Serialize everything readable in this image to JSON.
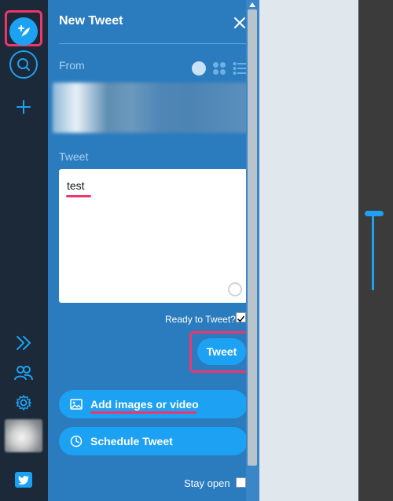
{
  "compose": {
    "title": "New Tweet",
    "from_label": "From",
    "tweet_label": "Tweet",
    "tweet_text": "test",
    "ready_label": "Ready to Tweet?",
    "ready_checked": true,
    "tweet_button": "Tweet",
    "add_media_button": "Add images or video",
    "schedule_button": "Schedule Tweet",
    "stay_open_label": "Stay open",
    "stay_open_checked": false
  },
  "sidebar": {
    "icons": [
      "compose-icon",
      "search-icon",
      "add-column-icon",
      "expand-icon",
      "people-icon",
      "gear-icon",
      "avatar",
      "twitter-icon"
    ]
  },
  "colors": {
    "accent": "#1da1f2",
    "panel": "#2b7bbf",
    "rail": "#1c2938",
    "highlight": "#f0356b"
  }
}
